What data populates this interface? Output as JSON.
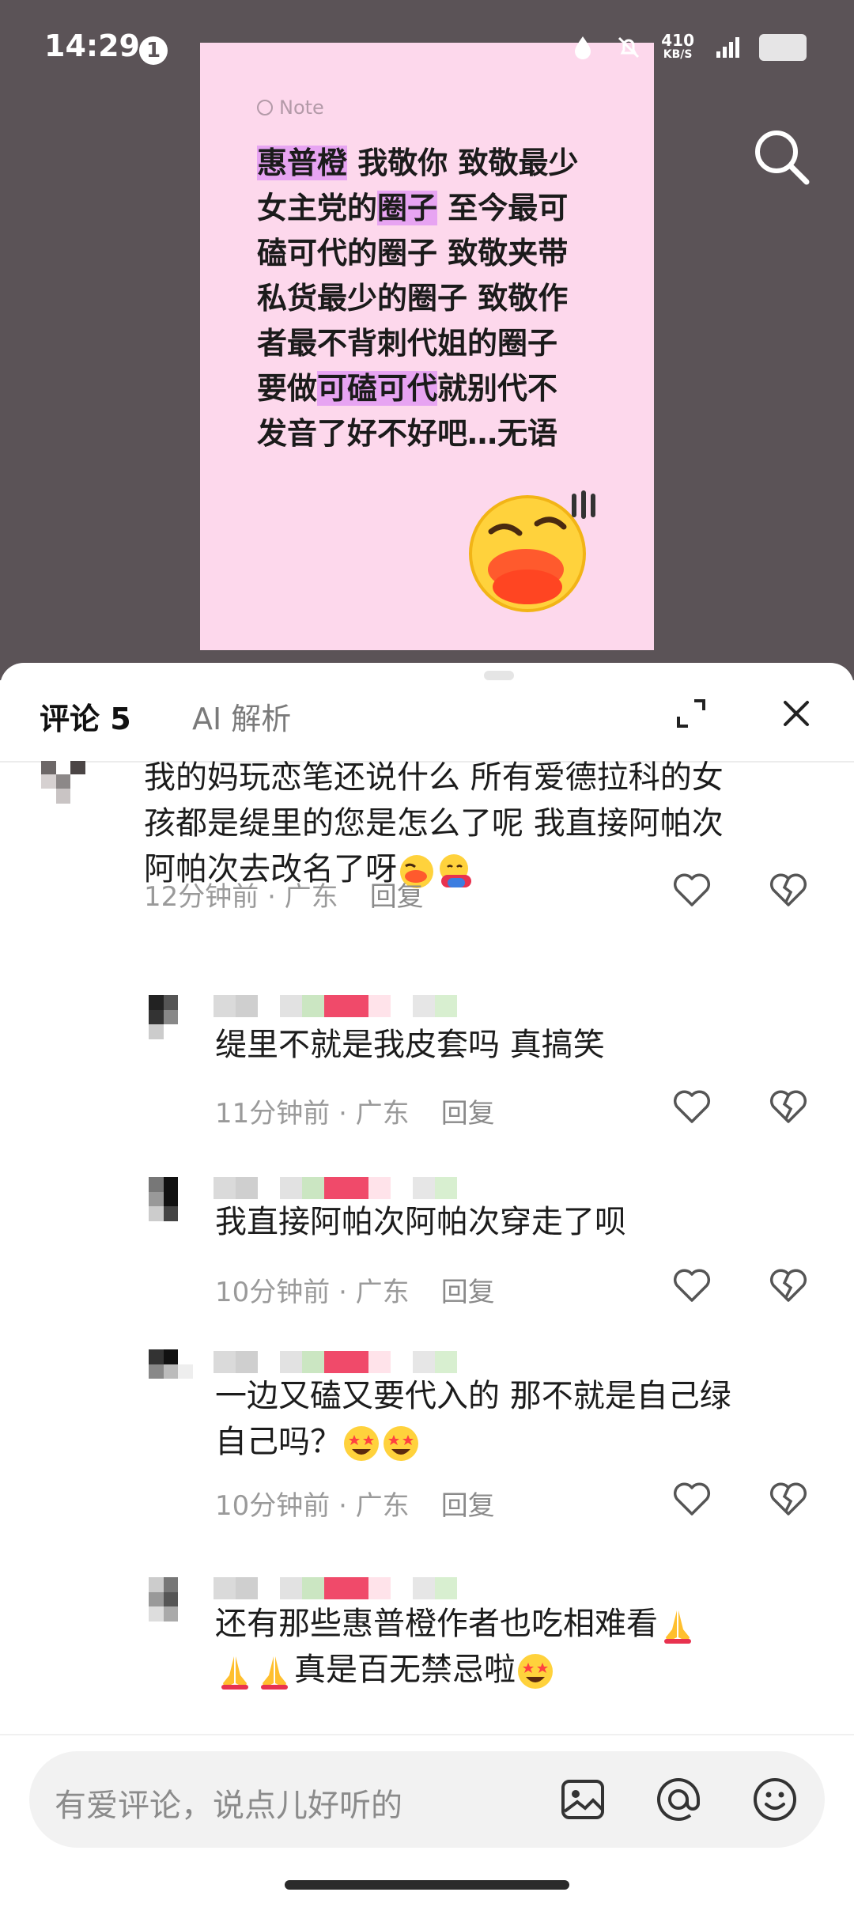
{
  "status_bar": {
    "time": "14:29",
    "notification_count": "1",
    "net_speed_value": "410",
    "net_speed_unit": "KB/S"
  },
  "note": {
    "label": "Note",
    "lines": [
      [
        {
          "t": "惠普橙",
          "hl": true
        },
        {
          "t": " 我敬你 致敬最少",
          "hl": false
        }
      ],
      [
        {
          "t": "女主党的",
          "hl": false
        },
        {
          "t": "圈子",
          "hl": true
        },
        {
          "t": " 至今最可",
          "hl": false
        }
      ],
      [
        {
          "t": "磕可代的圈子 致敬夹带",
          "hl": false
        }
      ],
      [
        {
          "t": "私货最少的圈子 致敬作",
          "hl": false
        }
      ],
      [
        {
          "t": "者最不背刺代姐的圈子",
          "hl": false
        }
      ],
      [
        {
          "t": "要做",
          "hl": false
        },
        {
          "t": "可磕可代",
          "hl": true
        },
        {
          "t": "就别代不",
          "hl": false
        }
      ],
      [
        {
          "t": "发音了好不好吧…无语",
          "hl": false
        }
      ]
    ],
    "highlight_color": "#e7a4f2",
    "card_color": "#fdd8ec"
  },
  "comment_panel": {
    "tab_comments": "评论 5",
    "tab_ai": "AI 解析"
  },
  "comments": [
    {
      "lines": [
        "我的妈玩恋笔还说什么 所有爱德拉科的女",
        "孩都是缇里的您是怎么了呢 我直接阿帕次",
        "阿帕次去改名了呀"
      ],
      "emojis": [
        "face-emoji",
        "hug-emoji"
      ],
      "time": "12分钟前 · 广东",
      "reply": "回复"
    },
    {
      "lines": [
        "缇里不就是我皮套吗 真搞笑"
      ],
      "emojis": [],
      "time": "11分钟前 · 广东",
      "reply": "回复"
    },
    {
      "lines": [
        "我直接阿帕次阿帕次穿走了呗"
      ],
      "emojis": [],
      "time": "10分钟前 · 广东",
      "reply": "回复"
    },
    {
      "lines": [
        "一边又磕又要代入的 那不就是自己绿",
        "自己吗？"
      ],
      "emojis": [
        "star-struck-emoji",
        "star-struck-emoji"
      ],
      "time": "10分钟前 · 广东",
      "reply": "回复"
    },
    {
      "lines": [
        "还有那些惠普橙作者也吃相难看",
        "真是百无禁忌啦"
      ],
      "emojis": [
        "folded-hands-emoji",
        "folded-hands-emoji",
        "folded-hands-emoji",
        "star-struck-emoji"
      ],
      "time": "",
      "reply": ""
    }
  ],
  "input": {
    "placeholder": "有爱评论，说点儿好听的"
  },
  "icons": [
    "search-icon",
    "expand-icon",
    "close-icon",
    "heart-icon",
    "broken-heart-icon",
    "image-icon",
    "at-icon",
    "emoji-icon"
  ]
}
